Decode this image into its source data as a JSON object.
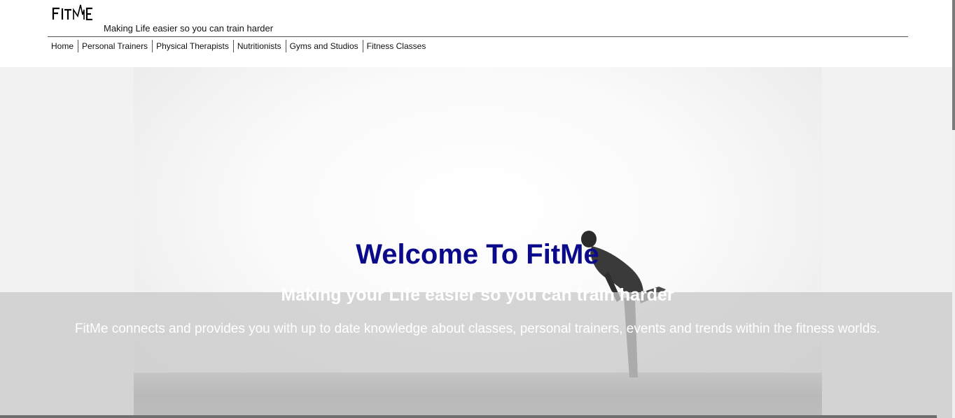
{
  "header": {
    "logo_text": "FITME",
    "tagline": "Making Life easier so you can train harder"
  },
  "nav": {
    "items": [
      {
        "label": "Home"
      },
      {
        "label": "Personal Trainers"
      },
      {
        "label": "Physical Therapists"
      },
      {
        "label": "Nutritionists"
      },
      {
        "label": "Gyms and Studios"
      },
      {
        "label": "Fitness Classes"
      }
    ]
  },
  "hero": {
    "title": "Welcome To FitMe",
    "subtitle": "Making your Life easier so you can train harder",
    "description": "FitMe connects and provides you with up to date knowledge about classes, personal trainers, events and trends within the fitness worlds."
  },
  "colors": {
    "title": "#0a0a8a",
    "overlay": "rgba(200,200,200,0.75)",
    "hero_bg": "#f2f2f2"
  },
  "icons": {
    "logo": "fitme-logo-icon",
    "hero_image": "man-stretching-photo"
  }
}
